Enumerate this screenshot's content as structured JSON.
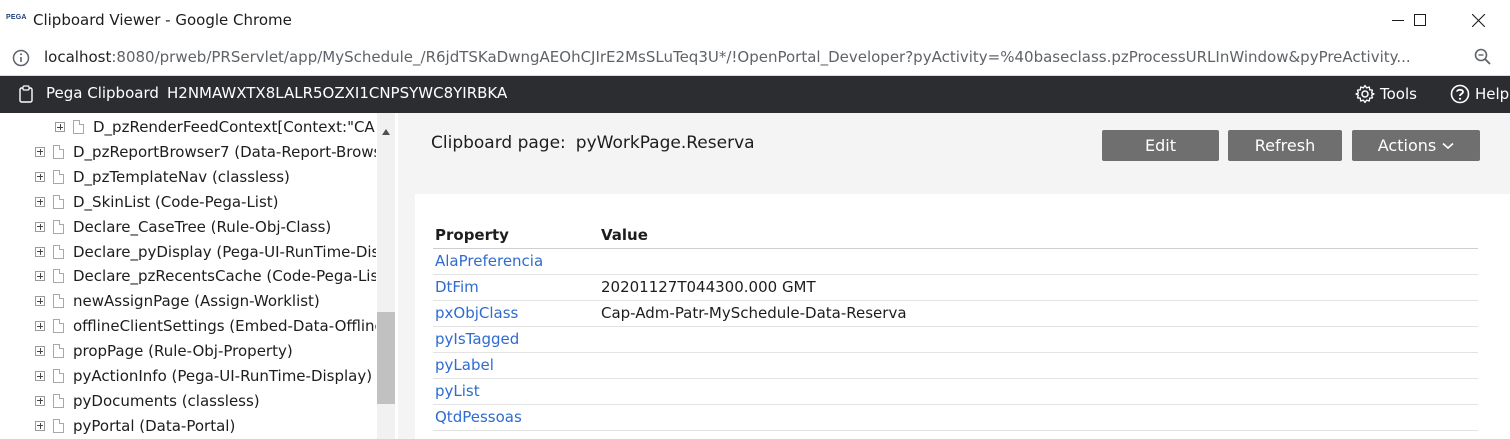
{
  "window": {
    "favicon_text": "PEGA",
    "title": "Clipboard Viewer - Google Chrome"
  },
  "address_bar": {
    "host": "localhost",
    "path": ":8080/prweb/PRServlet/app/MySchedule_/R6jdTSKaDwngAEOhCJIrE2MsSLuTeq3U*/!OpenPortal_Developer?pyActivity=%40baseclass.pzProcessURLInWindow&pyPreActivity..."
  },
  "header": {
    "app_name": "Pega Clipboard",
    "session_id": "H2NMAWXTX8LALR5OZXI1CNPSYWC8YIRBKA",
    "tools_label": "Tools",
    "help_label": "Help"
  },
  "tree": {
    "items": [
      {
        "label": "D_pzRenderFeedContext[Context:\"CAF",
        "expandable": true,
        "indent": 1
      },
      {
        "label": "D_pzReportBrowser7 (Data-Report-Brows",
        "expandable": true,
        "indent": 0
      },
      {
        "label": "D_pzTemplateNav (classless)",
        "expandable": true,
        "indent": 0
      },
      {
        "label": "D_SkinList (Code-Pega-List)",
        "expandable": true,
        "indent": 0
      },
      {
        "label": "Declare_CaseTree (Rule-Obj-Class)",
        "expandable": true,
        "indent": 0
      },
      {
        "label": "Declare_pyDisplay (Pega-UI-RunTime-Disp",
        "expandable": true,
        "indent": 0
      },
      {
        "label": "Declare_pzRecentsCache (Code-Pega-List)",
        "expandable": true,
        "indent": 0
      },
      {
        "label": "newAssignPage (Assign-Worklist)",
        "expandable": true,
        "indent": 0
      },
      {
        "label": "offlineClientSettings (Embed-Data-Offline",
        "expandable": true,
        "indent": 0
      },
      {
        "label": "propPage (Rule-Obj-Property)",
        "expandable": true,
        "indent": 0
      },
      {
        "label": "pyActionInfo (Pega-UI-RunTime-Display)",
        "expandable": true,
        "indent": 0
      },
      {
        "label": "pyDocuments (classless)",
        "expandable": true,
        "indent": 0
      },
      {
        "label": "pyPortal (Data-Portal)",
        "expandable": true,
        "indent": 0
      }
    ]
  },
  "main": {
    "heading_label": "Clipboard page:",
    "heading_value": "pyWorkPage.Reserva",
    "buttons": {
      "edit": "Edit",
      "refresh": "Refresh",
      "actions": "Actions"
    },
    "table": {
      "headers": [
        "Property",
        "Value"
      ],
      "rows": [
        {
          "property": "AlaPreferencia",
          "value": ""
        },
        {
          "property": "DtFim",
          "value": "20201127T044300.000 GMT"
        },
        {
          "property": "pxObjClass",
          "value": "Cap-Adm-Patr-MySchedule-Data-Reserva"
        },
        {
          "property": "pyIsTagged",
          "value": ""
        },
        {
          "property": "pyLabel",
          "value": ""
        },
        {
          "property": "pyList",
          "value": ""
        },
        {
          "property": "QtdPessoas",
          "value": ""
        }
      ]
    }
  },
  "colors": {
    "header_bg": "#2b2d31",
    "button_bg": "#6f6f6f",
    "link": "#2f6bd0",
    "content_bg": "#f4f4f4"
  }
}
